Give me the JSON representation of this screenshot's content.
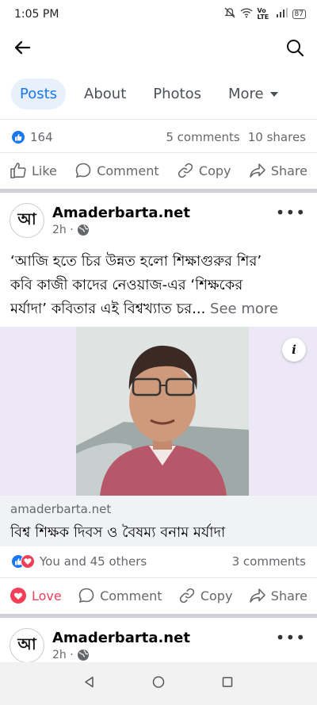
{
  "status_bar": {
    "time": "1:05 PM",
    "network": "Vo LTE",
    "battery": "87"
  },
  "tabs": [
    {
      "label": "Posts"
    },
    {
      "label": "About"
    },
    {
      "label": "Photos"
    },
    {
      "label": "More"
    }
  ],
  "post1": {
    "likes": "164",
    "comments": "5 comments",
    "shares": "10 shares"
  },
  "actions": {
    "like": "Like",
    "comment": "Comment",
    "copy": "Copy",
    "share": "Share",
    "love": "Love"
  },
  "post2": {
    "page_name": "Amaderbarta.net",
    "logo_text": "আ",
    "time": "2h ·",
    "text_line1": "‘আজি হতে চির উন্নত হলো শিক্ষাগুরুর শির’",
    "text_line2": "কবি কাজী কাদের নেওয়াজ-এর ‘শিক্ষকের",
    "text_line3": "মর্যাদা’ কবিতার এই বিশ্বখ্যাত চর...",
    "see_more": "See more",
    "link_domain": "amaderbarta.net",
    "link_title": "বিশ্ব শিক্ষক দিবস ও বৈষম্য বনাম মর্যাদা",
    "reactions_text": "You and 45 others",
    "comments": "3 comments"
  },
  "post3": {
    "page_name": "Amaderbarta.net",
    "logo_text": "আ",
    "time": "2h ·"
  },
  "colors": {
    "accent": "#1877f2",
    "love": "#f33e58",
    "text_secondary": "#65676b"
  }
}
